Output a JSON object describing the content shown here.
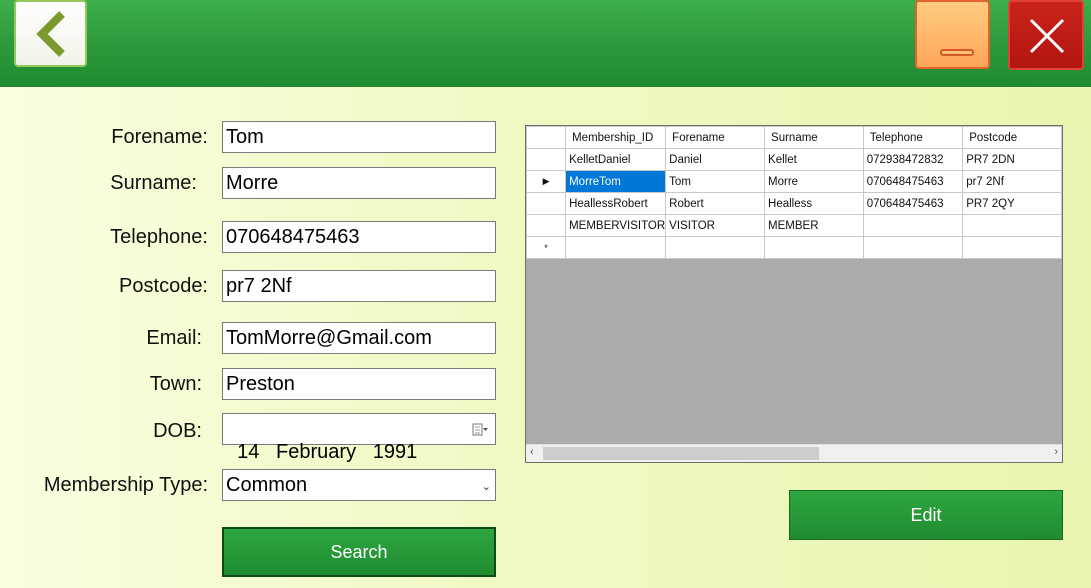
{
  "form": {
    "forename": {
      "label": "Forename:",
      "value": "Tom"
    },
    "surname": {
      "label": "Surname:",
      "value": "Morre"
    },
    "telephone": {
      "label": "Telephone:",
      "value": "070648475463"
    },
    "postcode": {
      "label": "Postcode:",
      "value": "pr7 2Nf"
    },
    "email": {
      "label": "Email:",
      "value": "TomMorre@Gmail.com"
    },
    "town": {
      "label": "Town:",
      "value": "Preston"
    },
    "dob": {
      "label": "DOB:",
      "value": "14   February   1991"
    },
    "membership_type": {
      "label": "Membership Type:",
      "value": "Common"
    }
  },
  "buttons": {
    "search": "Search",
    "edit": "Edit"
  },
  "grid": {
    "columns": [
      "Membership_ID",
      "Forename",
      "Surname",
      "Telephone",
      "Postcode"
    ],
    "rows": [
      [
        "KelletDaniel",
        "Daniel",
        "Kellet",
        "072938472832",
        "PR7 2DN"
      ],
      [
        "MorreTom",
        "Tom",
        "Morre",
        "070648475463",
        "pr7 2Nf"
      ],
      [
        "HeallessRobert",
        "Robert",
        "Healless",
        "070648475463",
        "PR7 2QY"
      ],
      [
        "MEMBERVISITOR",
        "VISITOR",
        "MEMBER",
        "",
        ""
      ],
      [
        "",
        "",
        "",
        "",
        ""
      ]
    ],
    "current_row_marker": "▶",
    "new_row_marker": "*"
  },
  "colors": {
    "header_green": "#2f9b3e",
    "button_green": "#1f8c30",
    "selection_blue": "#0078d7",
    "close_red": "#c8231b",
    "minimize_orange": "#ffa65a"
  },
  "icons": {
    "back": "chevron-left-icon",
    "minimize": "minimize-icon",
    "close": "close-icon",
    "calendar": "calendar-icon",
    "dropdown": "chevron-down-icon"
  }
}
